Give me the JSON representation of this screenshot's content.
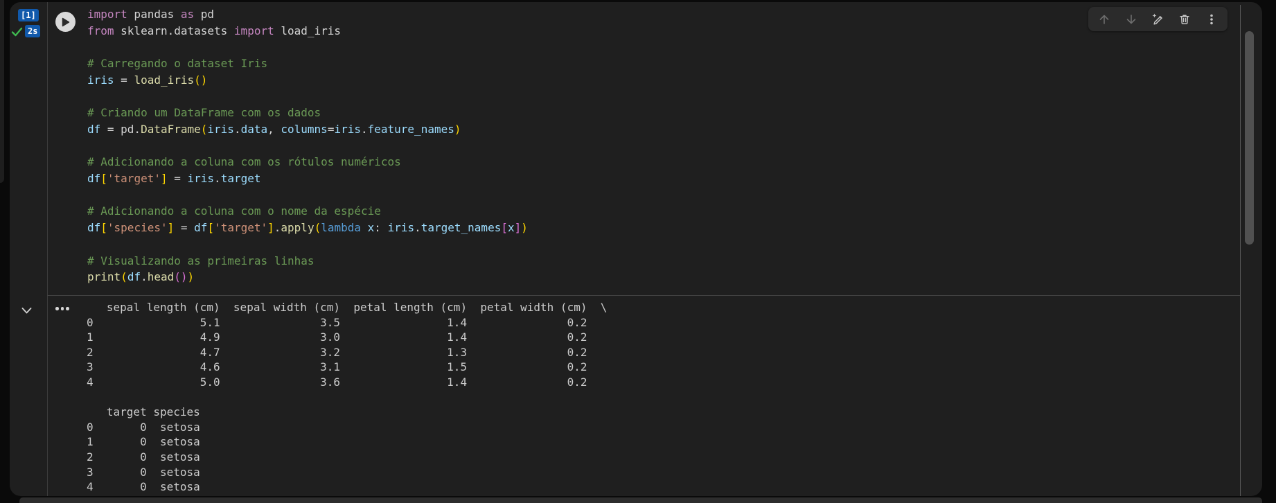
{
  "window": {
    "background": "#0a0a0a",
    "cell_background": "#1f1f1f"
  },
  "cell": {
    "execution_label": "[1]",
    "execution_time": "2s",
    "status": "success",
    "badge_color": "#1159ab",
    "check_color": "#3fb950",
    "run_icon": "play-icon"
  },
  "toolbar": {
    "icons": [
      {
        "name": "move-up-icon",
        "enabled": false
      },
      {
        "name": "move-down-icon",
        "enabled": false
      },
      {
        "name": "sparkle-edit-icon",
        "enabled": true
      },
      {
        "name": "delete-icon",
        "enabled": true
      },
      {
        "name": "more-actions-icon",
        "enabled": true
      }
    ]
  },
  "output_controls": {
    "collapse_icon": "chevron-down-icon",
    "menu_icon": "ellipsis-icon"
  },
  "colors": {
    "kw": "#C586C0",
    "kw2": "#569CD6",
    "cm": "#6A9955",
    "st": "#CE9178",
    "fn": "#DCDCAA",
    "va": "#9CDCFE",
    "pl": "#D4D4D4",
    "b1": "#FFD700",
    "b2": "#DA70D6"
  },
  "code": {
    "language": "python",
    "lines": [
      [
        [
          "kw",
          "import"
        ],
        [
          "pl",
          " pandas "
        ],
        [
          "kw",
          "as"
        ],
        [
          "pl",
          " pd"
        ]
      ],
      [
        [
          "kw",
          "from"
        ],
        [
          "pl",
          " sklearn.datasets "
        ],
        [
          "kw",
          "import"
        ],
        [
          "pl",
          " load_iris"
        ]
      ],
      [],
      [
        [
          "cm",
          "# Carregando o dataset Iris"
        ]
      ],
      [
        [
          "va",
          "iris"
        ],
        [
          "pl",
          " = "
        ],
        [
          "fn",
          "load_iris"
        ],
        [
          "b1",
          "()"
        ]
      ],
      [],
      [
        [
          "cm",
          "# Criando um DataFrame com os dados"
        ]
      ],
      [
        [
          "va",
          "df"
        ],
        [
          "pl",
          " = pd."
        ],
        [
          "fn",
          "DataFrame"
        ],
        [
          "b1",
          "("
        ],
        [
          "va",
          "iris"
        ],
        [
          "pl",
          "."
        ],
        [
          "va",
          "data"
        ],
        [
          "pl",
          ", "
        ],
        [
          "va",
          "columns"
        ],
        [
          "pl",
          "="
        ],
        [
          "va",
          "iris"
        ],
        [
          "pl",
          "."
        ],
        [
          "va",
          "feature_names"
        ],
        [
          "b1",
          ")"
        ]
      ],
      [],
      [
        [
          "cm",
          "# Adicionando a coluna com os rótulos numéricos"
        ]
      ],
      [
        [
          "va",
          "df"
        ],
        [
          "b1",
          "["
        ],
        [
          "st",
          "'target'"
        ],
        [
          "b1",
          "]"
        ],
        [
          "pl",
          " = "
        ],
        [
          "va",
          "iris"
        ],
        [
          "pl",
          "."
        ],
        [
          "va",
          "target"
        ]
      ],
      [],
      [
        [
          "cm",
          "# Adicionando a coluna com o nome da espécie"
        ]
      ],
      [
        [
          "va",
          "df"
        ],
        [
          "b1",
          "["
        ],
        [
          "st",
          "'species'"
        ],
        [
          "b1",
          "]"
        ],
        [
          "pl",
          " = "
        ],
        [
          "va",
          "df"
        ],
        [
          "b1",
          "["
        ],
        [
          "st",
          "'target'"
        ],
        [
          "b1",
          "]"
        ],
        [
          "pl",
          "."
        ],
        [
          "fn",
          "apply"
        ],
        [
          "b1",
          "("
        ],
        [
          "kw2",
          "lambda"
        ],
        [
          "pl",
          " "
        ],
        [
          "va",
          "x"
        ],
        [
          "pl",
          ": "
        ],
        [
          "va",
          "iris"
        ],
        [
          "pl",
          "."
        ],
        [
          "va",
          "target_names"
        ],
        [
          "b2",
          "["
        ],
        [
          "va",
          "x"
        ],
        [
          "b2",
          "]"
        ],
        [
          "b1",
          ")"
        ]
      ],
      [],
      [
        [
          "cm",
          "# Visualizando as primeiras linhas"
        ]
      ],
      [
        [
          "fn",
          "print"
        ],
        [
          "b1",
          "("
        ],
        [
          "va",
          "df"
        ],
        [
          "pl",
          "."
        ],
        [
          "fn",
          "head"
        ],
        [
          "b2",
          "()"
        ],
        [
          "b1",
          ")"
        ]
      ]
    ]
  },
  "output": {
    "lines": [
      "   sepal length (cm)  sepal width (cm)  petal length (cm)  petal width (cm)  \\",
      "0                5.1               3.5                1.4               0.2",
      "1                4.9               3.0                1.4               0.2",
      "2                4.7               3.2                1.3               0.2",
      "3                4.6               3.1                1.5               0.2",
      "4                5.0               3.6                1.4               0.2",
      "",
      "   target species",
      "0       0  setosa",
      "1       0  setosa",
      "2       0  setosa",
      "3       0  setosa",
      "4       0  setosa"
    ]
  }
}
